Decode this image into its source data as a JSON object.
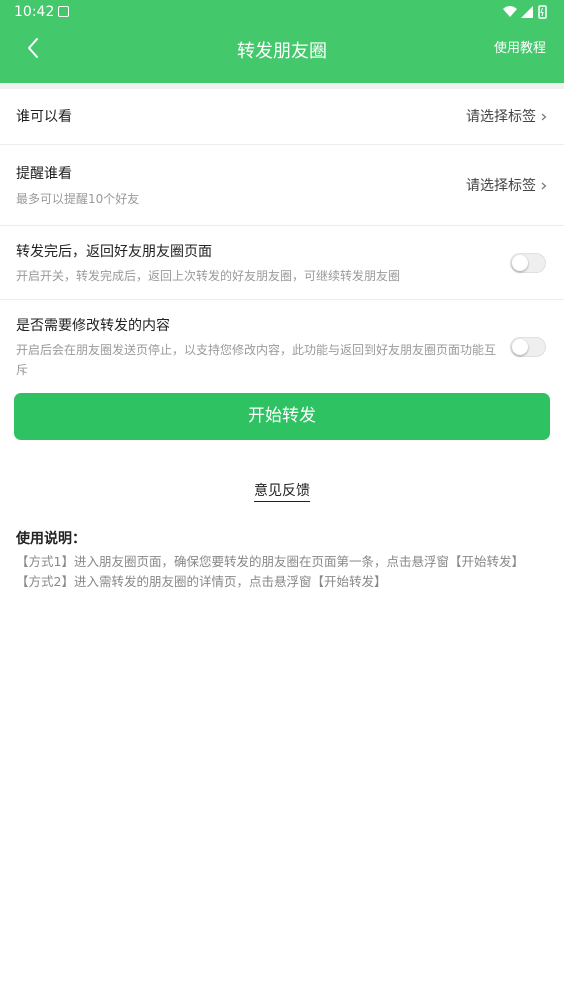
{
  "status_bar": {
    "time": "10:42",
    "app_icon": "a-square-icon",
    "icons": [
      "wifi-icon",
      "signal-icon",
      "battery-icon"
    ]
  },
  "app_bar": {
    "title": "转发朋友圈",
    "action_label": "使用教程",
    "back_icon": "chevron-left-icon",
    "background": "#44c86c"
  },
  "rows": {
    "visibility": {
      "title": "谁可以看",
      "value": "请选择标签"
    },
    "remind": {
      "title": "提醒谁看",
      "subtitle": "最多可以提醒10个好友",
      "value": "请选择标签"
    },
    "return_after": {
      "title": "转发完后，返回好友朋友圈页面",
      "subtitle": "开启开关，转发完成后，返回上次转发的好友朋友圈，可继续转发朋友圈",
      "enabled": false
    },
    "edit_content": {
      "title": "是否需要修改转发的内容",
      "subtitle": "开启后会在朋友圈发送页停止，以支持您修改内容，此功能与返回到好友朋友圈页面功能互斥",
      "enabled": false
    }
  },
  "start_button": {
    "label": "开始转发",
    "color": "#2ec263"
  },
  "feedback_link": "意见反馈",
  "instructions": {
    "title": "使用说明：",
    "lines": [
      "【方式1】进入朋友圈页面，确保您要转发的朋友圈在页面第一条，点击悬浮窗【开始转发】",
      "【方式2】进入需转发的朋友圈的详情页，点击悬浮窗【开始转发】"
    ]
  }
}
